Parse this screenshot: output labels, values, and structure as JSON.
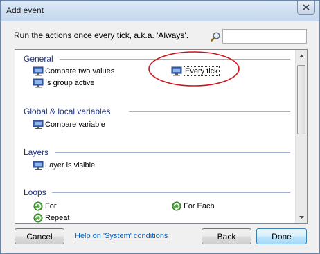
{
  "window": {
    "title": "Add event",
    "close_icon": "close-icon"
  },
  "description": "Run the actions once every tick, a.k.a. 'Always'.",
  "search": {
    "icon": "magnifier-icon",
    "value": "",
    "placeholder": ""
  },
  "categories": [
    {
      "name": "General",
      "items": [
        {
          "label": "Compare two values",
          "icon": "condition-icon"
        },
        {
          "label": "Every tick",
          "icon": "condition-icon",
          "selected": true
        },
        {
          "label": "Is group active",
          "icon": "condition-icon"
        }
      ]
    },
    {
      "name": "Global & local variables",
      "items": [
        {
          "label": "Compare variable",
          "icon": "condition-icon"
        }
      ]
    },
    {
      "name": "Layers",
      "items": [
        {
          "label": "Layer is visible",
          "icon": "condition-icon"
        }
      ]
    },
    {
      "name": "Loops",
      "items": [
        {
          "label": "For",
          "icon": "loop-icon"
        },
        {
          "label": "For Each",
          "icon": "loop-icon"
        },
        {
          "label": "Repeat",
          "icon": "loop-icon"
        }
      ]
    }
  ],
  "buttons": {
    "cancel": "Cancel",
    "help_link": "Help on 'System' conditions",
    "back": "Back",
    "done": "Done"
  },
  "colors": {
    "category_header": "#1e3287",
    "annotation": "#d0121b",
    "link": "#0066cc"
  }
}
